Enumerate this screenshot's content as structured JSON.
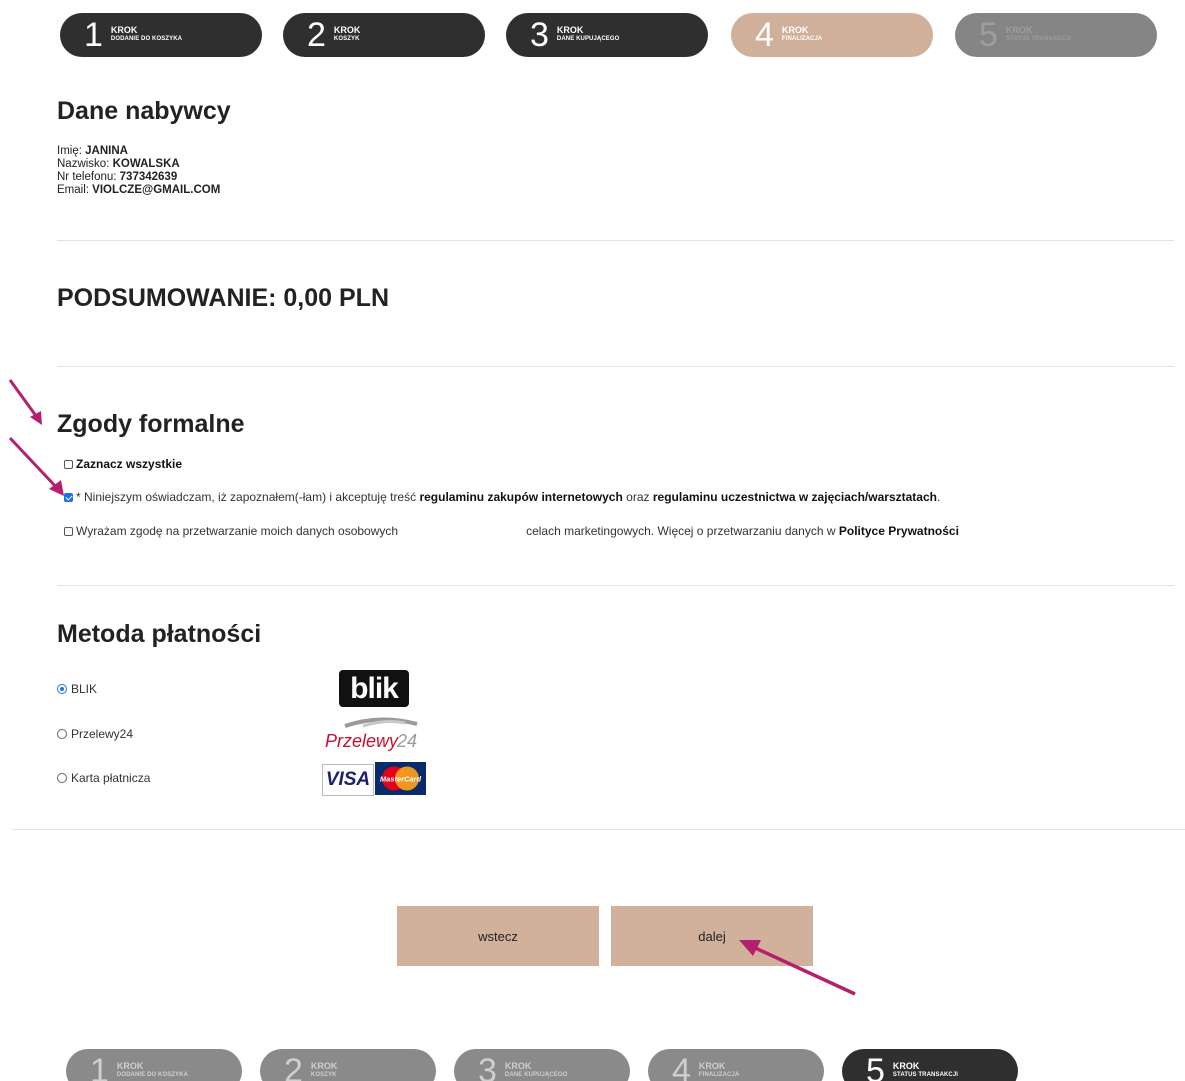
{
  "steps_top": [
    {
      "num": "1",
      "krok": "KROK",
      "desc": "Dodanie do koszyka",
      "state": "dark"
    },
    {
      "num": "2",
      "krok": "KROK",
      "desc": "Koszyk",
      "state": "dark"
    },
    {
      "num": "3",
      "krok": "KROK",
      "desc": "Dane kupującego",
      "state": "dark"
    },
    {
      "num": "4",
      "krok": "KROK",
      "desc": "Finalizacja",
      "state": "active"
    },
    {
      "num": "5",
      "krok": "KROK",
      "desc": "Status transakcji",
      "state": "dim"
    }
  ],
  "steps_bottom": [
    {
      "num": "1",
      "krok": "KROK",
      "desc": "Dodanie do koszyka",
      "state": "muted"
    },
    {
      "num": "2",
      "krok": "KROK",
      "desc": "Koszyk",
      "state": "muted"
    },
    {
      "num": "3",
      "krok": "KROK",
      "desc": "Dane kupującego",
      "state": "muted"
    },
    {
      "num": "4",
      "krok": "KROK",
      "desc": "Finalizacja",
      "state": "muted"
    },
    {
      "num": "5",
      "krok": "KROK",
      "desc": "Status transakcji",
      "state": "dark"
    }
  ],
  "buyer": {
    "title": "Dane nabywcy",
    "first_name_label": "Imię:",
    "first_name": "JANINA",
    "last_name_label": "Nazwisko:",
    "last_name": "KOWALSKA",
    "phone_label": "Nr telefonu:",
    "phone": "737342639",
    "email_label": "Email:",
    "email": "VIOLCZE@GMAIL.COM"
  },
  "summary": {
    "label": "PODSUMOWANIE:",
    "amount": "0,00 PLN"
  },
  "consents": {
    "title": "Zgody formalne",
    "select_all": "Zaznacz wszystkie",
    "terms_prefix": "* Niniejszym oświadczam, iż zapoznałem(-łam) i akceptuję treść",
    "terms_link1": "regulaminu zakupów internetowych",
    "terms_mid": "oraz",
    "terms_link2": "regulaminu uczestnictwa w zajęciach/warsztatach",
    "terms_end": ".",
    "marketing_prefix": "Wyrażam zgodę na przetwarzanie moich danych osobowych",
    "marketing_mid": "celach marketingowych. Więcej o przetwarzaniu danych w",
    "marketing_link": "Polityce Prywatności"
  },
  "payment": {
    "title": "Metoda płatności",
    "options": [
      {
        "label": "BLIK",
        "selected": true,
        "logo": "blik-logo"
      },
      {
        "label": "Przelewy24",
        "selected": false,
        "logo": "przelewy24-logo"
      },
      {
        "label": "Karta płatnicza",
        "selected": false,
        "logo": "visa-mastercard-logo"
      }
    ],
    "blik_logo_text": "blik",
    "p24_logo_text": "Przelewy",
    "p24_logo_num": "24",
    "visa_text": "VISA",
    "mc_text": "MasterCard"
  },
  "buttons": {
    "back": "wstecz",
    "next": "dalej"
  },
  "colors": {
    "accent": "#d0b09b",
    "dark": "#2f2f2f",
    "arrow": "#b5206e",
    "check": "#1a73e8"
  }
}
